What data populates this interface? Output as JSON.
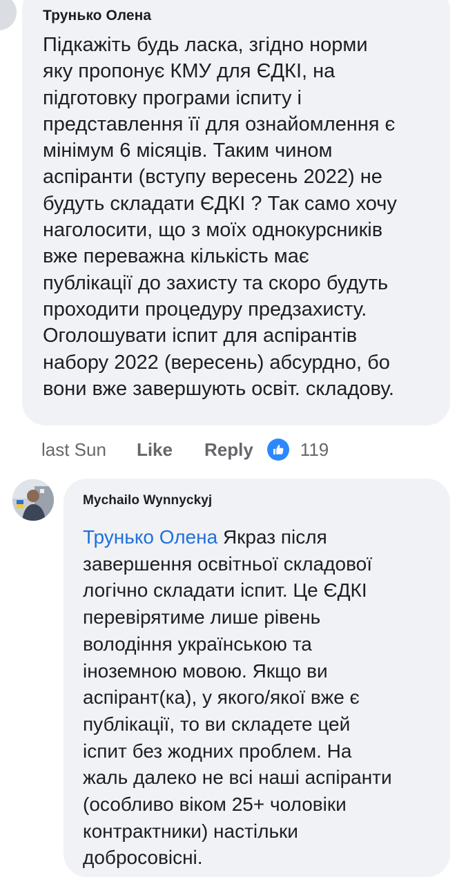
{
  "comment_1": {
    "author": "Трунько Олена",
    "lines": [
      "Підкажіть будь ласка, згідно норми",
      "яку пропонує КМУ для ЄДКІ, на",
      "підготовку програми іспиту і",
      "представлення її для ознайомлення є",
      "мінімум 6 місяців. Таким чином",
      "аспіранти (вступу вересень 2022) не",
      "будуть складати ЄДКІ ? Так само хочу",
      "наголосити, що з моїх однокурсників",
      "вже переважна кількість має",
      "публікації до захисту та скоро будуть",
      "проходити процедуру предзахисту.",
      "Оголошувати іспит для аспірантів",
      "набору 2022 (вересень) абсурдно, бо",
      "вони вже завершують освіт. складову."
    ]
  },
  "actions": {
    "time": "last Sun",
    "like_label": "Like",
    "reply_label": "Reply",
    "like_count": "119",
    "like_icon": "thumbs-up-icon",
    "like_icon_color": "#2d88ff"
  },
  "comment_2": {
    "author": "Mychailo Wynnyckyj",
    "mention": "Трунько Олена",
    "first_line_rest": " Якраз після",
    "lines": [
      "завершення освітньої складової",
      "логічно складати іспит. Це ЄДКІ",
      "перевірятиме лише рівень",
      "володіння українською та",
      "іноземною мовою. Якщо ви",
      "аспірант(ка), у якого/якої вже є",
      "публікації, то ви складете цей",
      "іспит без жодних проблем. На",
      "жаль далеко не всі наші аспіранти",
      "(особливо віком 25+ чоловіки",
      "контрактники) настільки",
      "добросовісні."
    ]
  },
  "colors": {
    "bubble_bg": "#f0f2f5",
    "mention": "#216fdb",
    "meta_text": "#65676b"
  }
}
